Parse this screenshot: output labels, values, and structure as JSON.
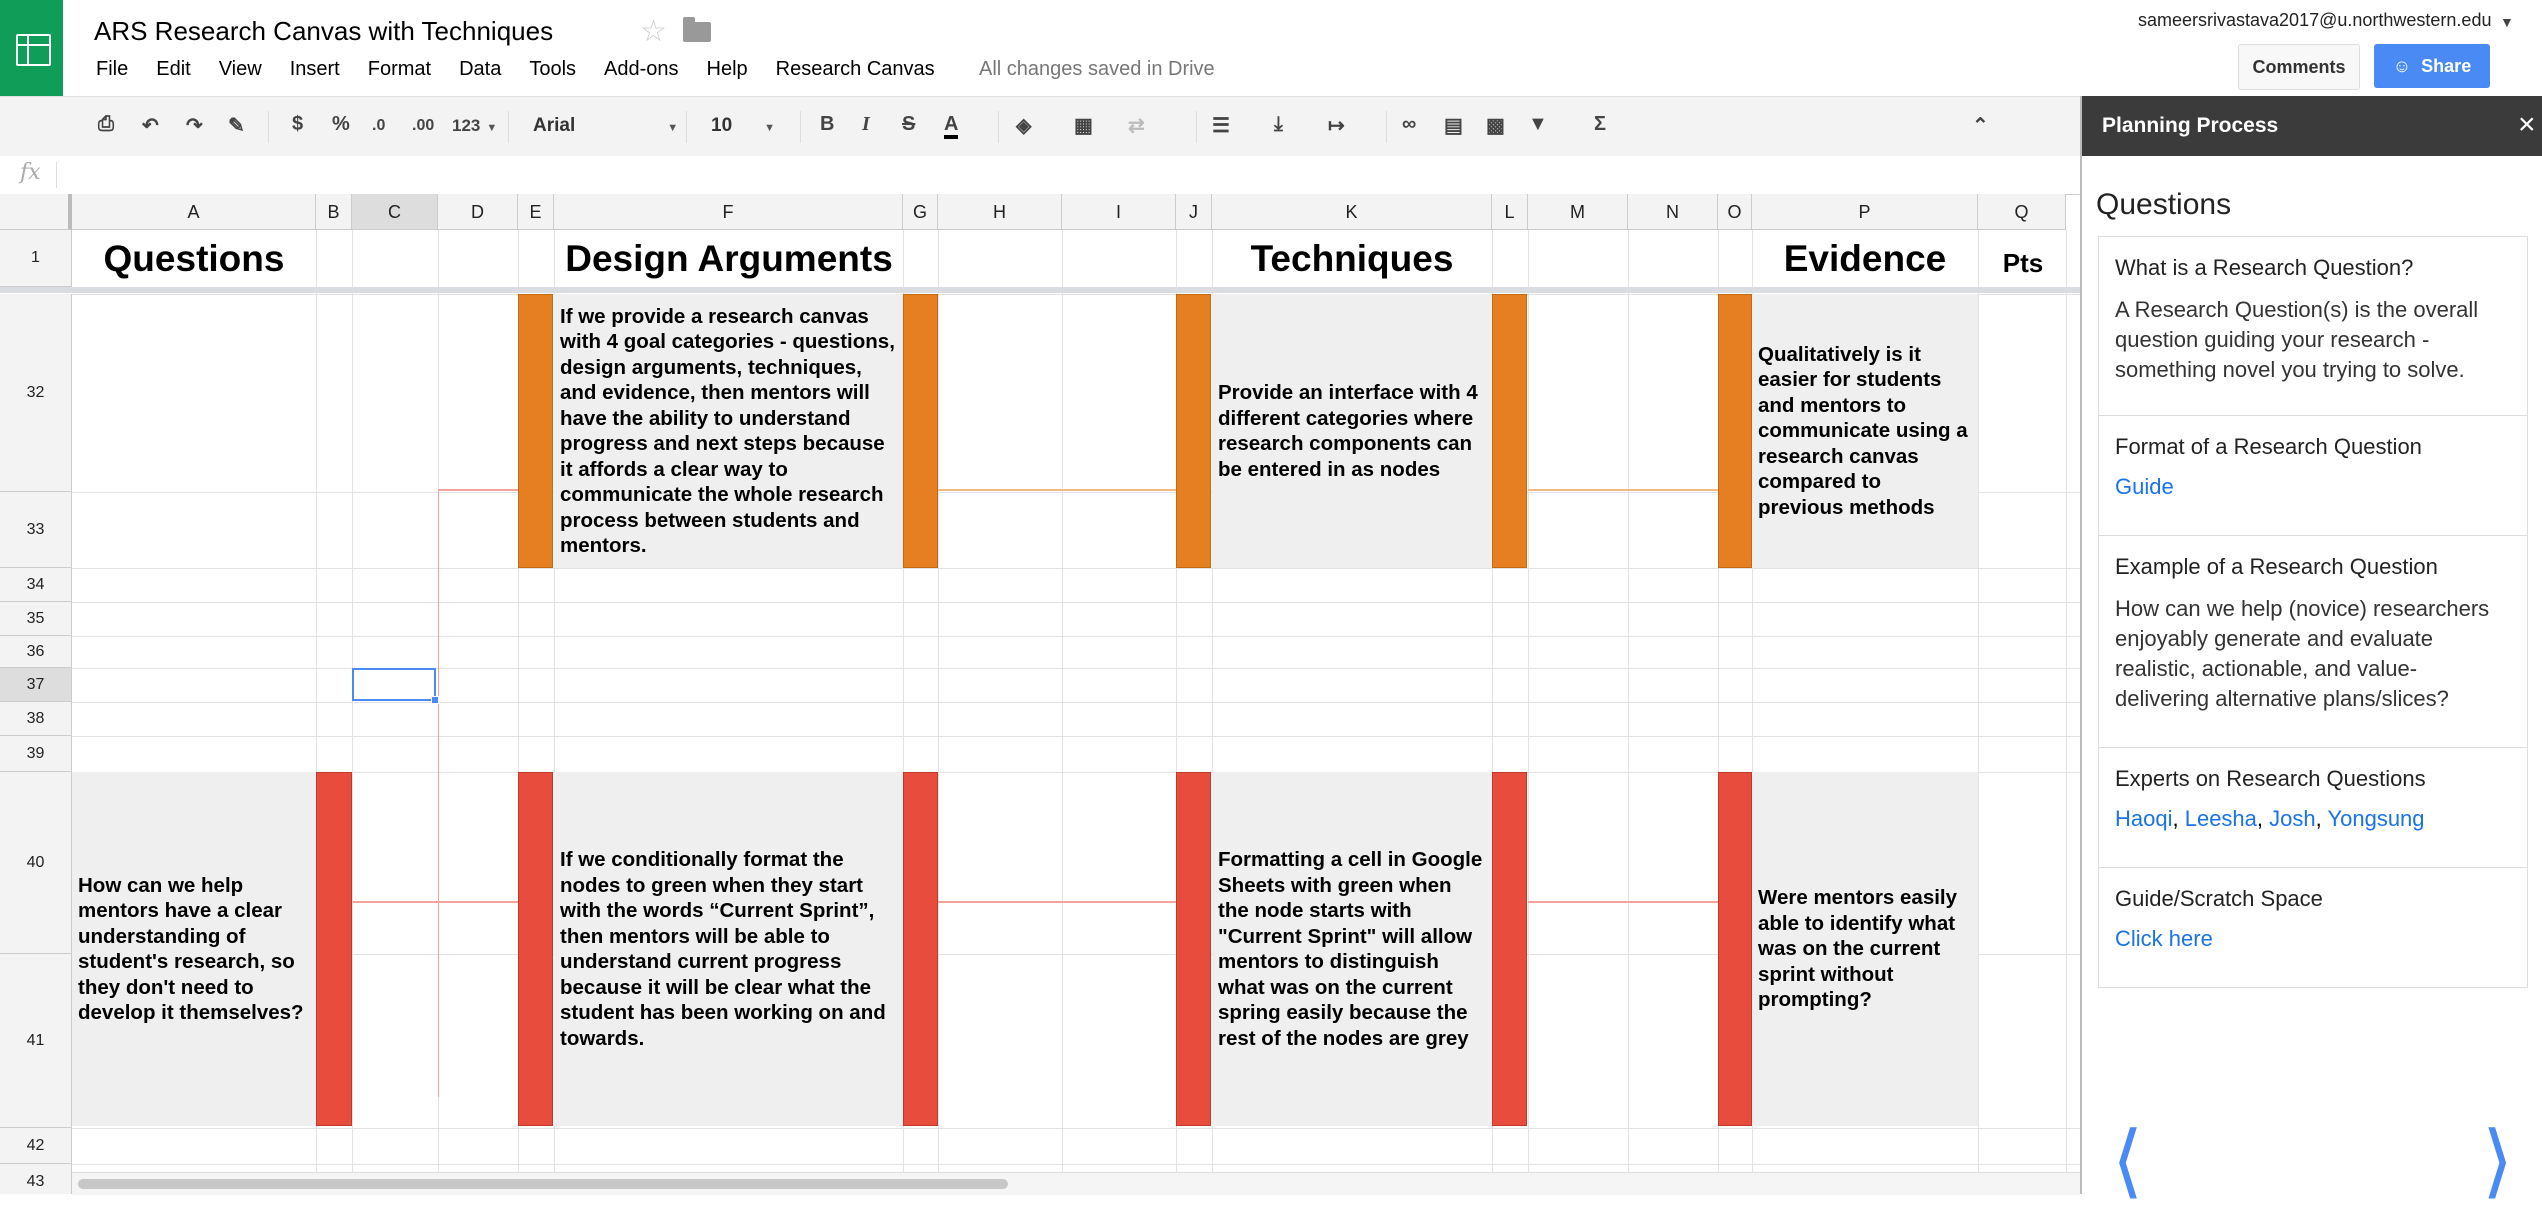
{
  "header": {
    "title": "ARS Research Canvas with Techniques",
    "menu": [
      "File",
      "Edit",
      "View",
      "Insert",
      "Format",
      "Data",
      "Tools",
      "Add-ons",
      "Help",
      "Research Canvas"
    ],
    "save_status": "All changes saved in Drive",
    "user_email": "sameersrivastava2017@u.northwestern.edu",
    "comments_label": "Comments",
    "share_label": "Share"
  },
  "toolbar": {
    "currency": "$",
    "percent": "%",
    "dec_less": ".0",
    "dec_more": ".00",
    "number_format": "123",
    "font": "Arial",
    "font_size": "10",
    "bold": "B",
    "italic": "I",
    "strike": "S",
    "text_color": "A",
    "sigma": "Σ"
  },
  "formula_bar": {
    "fx_label": "fx",
    "value": ""
  },
  "columns": [
    {
      "id": "A"
    },
    {
      "id": "B"
    },
    {
      "id": "C"
    },
    {
      "id": "D"
    },
    {
      "id": "E"
    },
    {
      "id": "F"
    },
    {
      "id": "G"
    },
    {
      "id": "H"
    },
    {
      "id": "I"
    },
    {
      "id": "J"
    },
    {
      "id": "K"
    },
    {
      "id": "L"
    },
    {
      "id": "M"
    },
    {
      "id": "N"
    },
    {
      "id": "O"
    },
    {
      "id": "P"
    },
    {
      "id": "Q"
    }
  ],
  "rows": [
    "1",
    "32",
    "33",
    "34",
    "35",
    "36",
    "37",
    "38",
    "39",
    "40",
    "41",
    "42",
    "43"
  ],
  "sheet": {
    "headers": {
      "questions": "Questions",
      "design_arguments": "Design Arguments",
      "techniques": "Techniques",
      "evidence": "Evidence",
      "pts": "Pts"
    },
    "row32": {
      "design": "If we provide a research canvas with 4 goal categories - questions, design arguments, techniques, and evidence, then mentors will have the ability to understand progress and next steps because it affords a clear way to communicate the whole research process between students and mentors.",
      "technique": "Provide an interface with 4 different categories where research components can be entered in as nodes",
      "evidence": "Qualitatively is it easier for students and mentors to communicate using a research canvas compared to previous methods"
    },
    "row40": {
      "question": "How can we help mentors have a clear understanding of student's research, so they don't need to develop it themselves?",
      "design": "If we conditionally format the nodes to green when they start with the words “Current Sprint”, then mentors will be able to understand current progress because it will be clear what the student has been working on and towards.",
      "technique": "Formatting a cell in Google Sheets with green when the node starts with \"Current Sprint\" will allow mentors to distinguish what was on the current spring easily because the rest of the nodes are grey",
      "evidence": "Were mentors easily able to identify what was on the current sprint without prompting?"
    }
  },
  "sidebar": {
    "title": "Planning Process",
    "heading": "Questions",
    "sections": [
      {
        "heading": "What is a Research Question?",
        "text": "A Research Question(s) is the overall question guiding your research - something novel you trying to solve."
      },
      {
        "heading": "Format of a Research Question",
        "link": "Guide"
      },
      {
        "heading": "Example of a Research Question",
        "text": "How can we help (novice) researchers enjoyably generate and evaluate realistic, actionable, and value-delivering alternative plans/slices?"
      },
      {
        "heading": "Experts on Research Questions",
        "links": [
          "Haoqi",
          "Leesha",
          "Josh",
          "Yongsung"
        ]
      },
      {
        "heading": "Guide/Scratch Space",
        "link": "Click here"
      }
    ]
  },
  "colors": {
    "red_bar": "#e74c3c",
    "orange_bar": "#e67e22",
    "accent": "#4a8af4",
    "sheets_green": "#0f9d58"
  }
}
